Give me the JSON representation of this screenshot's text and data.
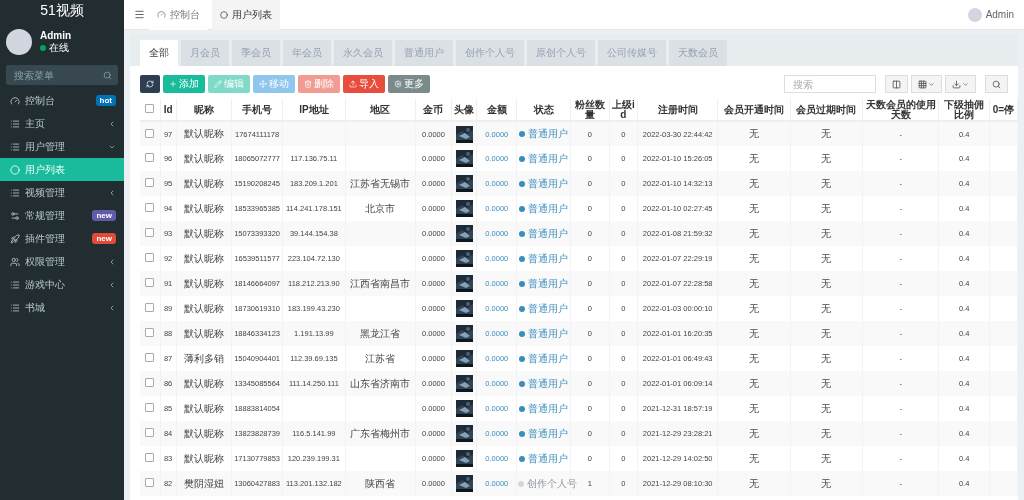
{
  "sidebar": {
    "logo": "51视频",
    "user": {
      "name": "Admin",
      "status": "在线"
    },
    "search": {
      "placeholder": "搜索菜单"
    },
    "items": [
      {
        "label": "控制台",
        "selected": false,
        "badge": {
          "text": "hot",
          "color": "#0073b7"
        }
      },
      {
        "label": "主页",
        "selected": false,
        "expanded": false
      },
      {
        "label": "用户管理",
        "selected": false,
        "expanded": true,
        "children": [
          {
            "label": "用户列表",
            "selected": true
          }
        ]
      },
      {
        "label": "视频管理",
        "selected": false,
        "expanded": false
      },
      {
        "label": "常规管理",
        "selected": false,
        "badge": {
          "text": "new",
          "color": "#605ca8"
        }
      },
      {
        "label": "插件管理",
        "selected": false,
        "badge": {
          "text": "new",
          "color": "#dd4b39"
        }
      },
      {
        "label": "权限管理",
        "selected": false,
        "expanded": false
      },
      {
        "label": "游戏中心",
        "selected": false,
        "expanded": false
      },
      {
        "label": "书城",
        "selected": false,
        "expanded": false
      }
    ]
  },
  "topbar": {
    "tabs": [
      {
        "label": "控制台",
        "selected": false
      },
      {
        "label": "用户列表",
        "selected": true
      }
    ],
    "user": "Admin"
  },
  "filter_tabs": [
    {
      "label": "全部",
      "selected": true
    },
    {
      "label": "月会员",
      "selected": false
    },
    {
      "label": "季会员",
      "selected": false
    },
    {
      "label": "年会员",
      "selected": false
    },
    {
      "label": "永久会员",
      "selected": false
    },
    {
      "label": "普通用户",
      "selected": false
    },
    {
      "label": "创作个人号",
      "selected": false
    },
    {
      "label": "原创个人号",
      "selected": false
    },
    {
      "label": "公司传媒号",
      "selected": false
    },
    {
      "label": "天数会员",
      "selected": false
    }
  ],
  "toolbar": {
    "buttons": [
      {
        "kind": "refresh",
        "disabled": false
      },
      {
        "kind": "add",
        "label": "添加",
        "disabled": false
      },
      {
        "kind": "edit",
        "label": "编辑",
        "disabled": true
      },
      {
        "kind": "move",
        "label": "移动",
        "disabled": true
      },
      {
        "kind": "delete",
        "label": "删除",
        "disabled": true
      },
      {
        "kind": "import",
        "label": "导入",
        "disabled": false
      },
      {
        "kind": "more",
        "label": "更多",
        "disabled": false
      }
    ],
    "search": {
      "placeholder": "搜索"
    }
  },
  "table": {
    "select_all": {
      "checked": false
    },
    "columns": [
      "Id",
      "昵称",
      "手机号",
      "IP地址",
      "地区",
      "金币",
      "头像",
      "金额",
      "状态",
      "粉丝数量",
      "上级id",
      "注册时间",
      "会员开通时间",
      "会员过期时间",
      "天数会员的使用天数",
      "下级抽佣比例",
      "0=停"
    ],
    "rows": [
      {
        "checked": false,
        "id": "97",
        "nickname": "默认昵称",
        "phone": "17674111178",
        "ip": "",
        "region": "",
        "coins": "0.0000",
        "balance": "0.0000",
        "status": {
          "label": "普通用户",
          "color": "#3c8dbc"
        },
        "fans": "0",
        "parent_id": "0",
        "registered": "2022-03-30 22:44:42",
        "vip_start": "无",
        "vip_end": "无",
        "days": "-",
        "ratio": "0.4"
      },
      {
        "checked": false,
        "id": "96",
        "nickname": "默认昵称",
        "phone": "18065072777",
        "ip": "117.136.75.11",
        "region": "",
        "coins": "0.0000",
        "balance": "0.0000",
        "status": {
          "label": "普通用户",
          "color": "#3c8dbc"
        },
        "fans": "0",
        "parent_id": "0",
        "registered": "2022-01-10 15:26:05",
        "vip_start": "无",
        "vip_end": "无",
        "days": "-",
        "ratio": "0.4"
      },
      {
        "checked": false,
        "id": "95",
        "nickname": "默认昵称",
        "phone": "15190208245",
        "ip": "183.209.1.201",
        "region": "江苏省无锡市",
        "coins": "0.0000",
        "balance": "0.0000",
        "status": {
          "label": "普通用户",
          "color": "#3c8dbc"
        },
        "fans": "0",
        "parent_id": "0",
        "registered": "2022-01-10 14:32:13",
        "vip_start": "无",
        "vip_end": "无",
        "days": "-",
        "ratio": "0.4"
      },
      {
        "checked": false,
        "id": "94",
        "nickname": "默认昵称",
        "phone": "18533965385",
        "ip": "114.241.178.151",
        "region": "北京市",
        "coins": "0.0000",
        "balance": "0.0000",
        "status": {
          "label": "普通用户",
          "color": "#3c8dbc"
        },
        "fans": "0",
        "parent_id": "0",
        "registered": "2022-01-10 02:27:45",
        "vip_start": "无",
        "vip_end": "无",
        "days": "-",
        "ratio": "0.4"
      },
      {
        "checked": false,
        "id": "93",
        "nickname": "默认昵称",
        "phone": "15073393320",
        "ip": "39.144.154.38",
        "region": "",
        "coins": "0.0000",
        "balance": "0.0000",
        "status": {
          "label": "普通用户",
          "color": "#3c8dbc"
        },
        "fans": "0",
        "parent_id": "0",
        "registered": "2022-01-08 21:59:32",
        "vip_start": "无",
        "vip_end": "无",
        "days": "-",
        "ratio": "0.4"
      },
      {
        "checked": false,
        "id": "92",
        "nickname": "默认昵称",
        "phone": "16539511577",
        "ip": "223.104.72.130",
        "region": "",
        "coins": "0.0000",
        "balance": "0.0000",
        "status": {
          "label": "普通用户",
          "color": "#3c8dbc"
        },
        "fans": "0",
        "parent_id": "0",
        "registered": "2022-01-07 22:29:19",
        "vip_start": "无",
        "vip_end": "无",
        "days": "-",
        "ratio": "0.4"
      },
      {
        "checked": false,
        "id": "91",
        "nickname": "默认昵称",
        "phone": "18146664097",
        "ip": "118.212.213.90",
        "region": "江西省南昌市",
        "coins": "0.0000",
        "balance": "0.0000",
        "status": {
          "label": "普通用户",
          "color": "#3c8dbc"
        },
        "fans": "0",
        "parent_id": "0",
        "registered": "2022-01-07 22:28:58",
        "vip_start": "无",
        "vip_end": "无",
        "days": "-",
        "ratio": "0.4"
      },
      {
        "checked": false,
        "id": "89",
        "nickname": "默认昵称",
        "phone": "18730619310",
        "ip": "183.199.43.230",
        "region": "",
        "coins": "0.0000",
        "balance": "0.0000",
        "status": {
          "label": "普通用户",
          "color": "#3c8dbc"
        },
        "fans": "0",
        "parent_id": "0",
        "registered": "2022-01-03 00:00:10",
        "vip_start": "无",
        "vip_end": "无",
        "days": "-",
        "ratio": "0.4"
      },
      {
        "checked": false,
        "id": "88",
        "nickname": "默认昵称",
        "phone": "18846334123",
        "ip": "1.191.13.99",
        "region": "黑龙江省",
        "coins": "0.0000",
        "balance": "0.0000",
        "status": {
          "label": "普通用户",
          "color": "#3c8dbc"
        },
        "fans": "0",
        "parent_id": "0",
        "registered": "2022-01-01 16:20:35",
        "vip_start": "无",
        "vip_end": "无",
        "days": "-",
        "ratio": "0.4"
      },
      {
        "checked": false,
        "id": "87",
        "nickname": "薄利多销",
        "phone": "15040904401",
        "ip": "112.39.69.135",
        "region": "江苏省",
        "coins": "0.0000",
        "balance": "0.0000",
        "status": {
          "label": "普通用户",
          "color": "#3c8dbc"
        },
        "fans": "0",
        "parent_id": "0",
        "registered": "2022-01-01 06:49:43",
        "vip_start": "无",
        "vip_end": "无",
        "days": "-",
        "ratio": "0.4"
      },
      {
        "checked": false,
        "id": "86",
        "nickname": "默认昵称",
        "phone": "13345085564",
        "ip": "111.14.250.111",
        "region": "山东省济南市",
        "coins": "0.0000",
        "balance": "0.0000",
        "status": {
          "label": "普通用户",
          "color": "#3c8dbc"
        },
        "fans": "0",
        "parent_id": "0",
        "registered": "2022-01-01 06:09:14",
        "vip_start": "无",
        "vip_end": "无",
        "days": "-",
        "ratio": "0.4"
      },
      {
        "checked": false,
        "id": "85",
        "nickname": "默认昵称",
        "phone": "18883814054",
        "ip": "",
        "region": "",
        "coins": "0.0000",
        "balance": "0.0000",
        "status": {
          "label": "普通用户",
          "color": "#3c8dbc"
        },
        "fans": "0",
        "parent_id": "0",
        "registered": "2021-12-31 18:57:19",
        "vip_start": "无",
        "vip_end": "无",
        "days": "-",
        "ratio": "0.4"
      },
      {
        "checked": false,
        "id": "84",
        "nickname": "默认昵称",
        "phone": "13823828739",
        "ip": "116.5.141.99",
        "region": "广东省梅州市",
        "coins": "0.0000",
        "balance": "0.0000",
        "status": {
          "label": "普通用户",
          "color": "#3c8dbc"
        },
        "fans": "0",
        "parent_id": "0",
        "registered": "2021-12-29 23:28:21",
        "vip_start": "无",
        "vip_end": "无",
        "days": "-",
        "ratio": "0.4"
      },
      {
        "checked": false,
        "id": "83",
        "nickname": "默认昵称",
        "phone": "17130779853",
        "ip": "120.239.199.31",
        "region": "",
        "coins": "0.0000",
        "balance": "0.0000",
        "status": {
          "label": "普通用户",
          "color": "#3c8dbc"
        },
        "fans": "0",
        "parent_id": "0",
        "registered": "2021-12-29 14:02:50",
        "vip_start": "无",
        "vip_end": "无",
        "days": "-",
        "ratio": "0.4"
      },
      {
        "checked": false,
        "id": "82",
        "nickname": "樊阴湿妞",
        "phone": "13060427883",
        "ip": "113.201.132.182",
        "region": "陕西省",
        "coins": "0.0000",
        "balance": "0.0000",
        "status": {
          "label": "创作个人号",
          "color": "#d2d6de"
        },
        "fans": "1",
        "parent_id": "0",
        "registered": "2021-12-29 08:10:30",
        "vip_start": "无",
        "vip_end": "无",
        "days": "-",
        "ratio": "0.4"
      }
    ]
  }
}
